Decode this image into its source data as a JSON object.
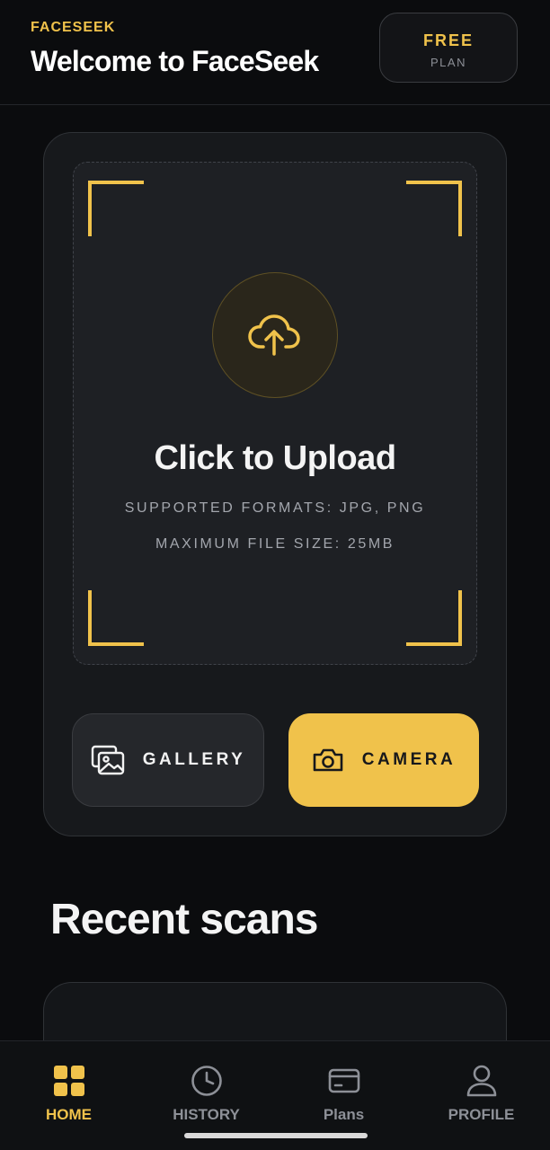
{
  "header": {
    "brand": "FACESEEK",
    "welcome": "Welcome to FaceSeek",
    "plan": {
      "label": "FREE",
      "sublabel": "PLAN"
    }
  },
  "upload": {
    "icon": "cloud-upload-icon",
    "title": "Click to Upload",
    "formats": "SUPPORTED FORMATS: JPG, PNG",
    "max_size": "MAXIMUM FILE SIZE: 25MB"
  },
  "actions": {
    "gallery": {
      "label": "GALLERY",
      "icon": "gallery-icon"
    },
    "camera": {
      "label": "CAMERA",
      "icon": "camera-icon"
    }
  },
  "recent": {
    "title": "Recent scans"
  },
  "nav": {
    "items": [
      {
        "label": "HOME",
        "icon": "grid-icon",
        "active": true
      },
      {
        "label": "HISTORY",
        "icon": "clock-icon",
        "active": false
      },
      {
        "label": "Plans",
        "icon": "card-icon",
        "active": false
      },
      {
        "label": "PROFILE",
        "icon": "user-icon",
        "active": false
      }
    ]
  },
  "colors": {
    "accent": "#f0c24b",
    "background": "#0b0c0e",
    "card": "#17191c",
    "muted_text": "#8d9097"
  }
}
